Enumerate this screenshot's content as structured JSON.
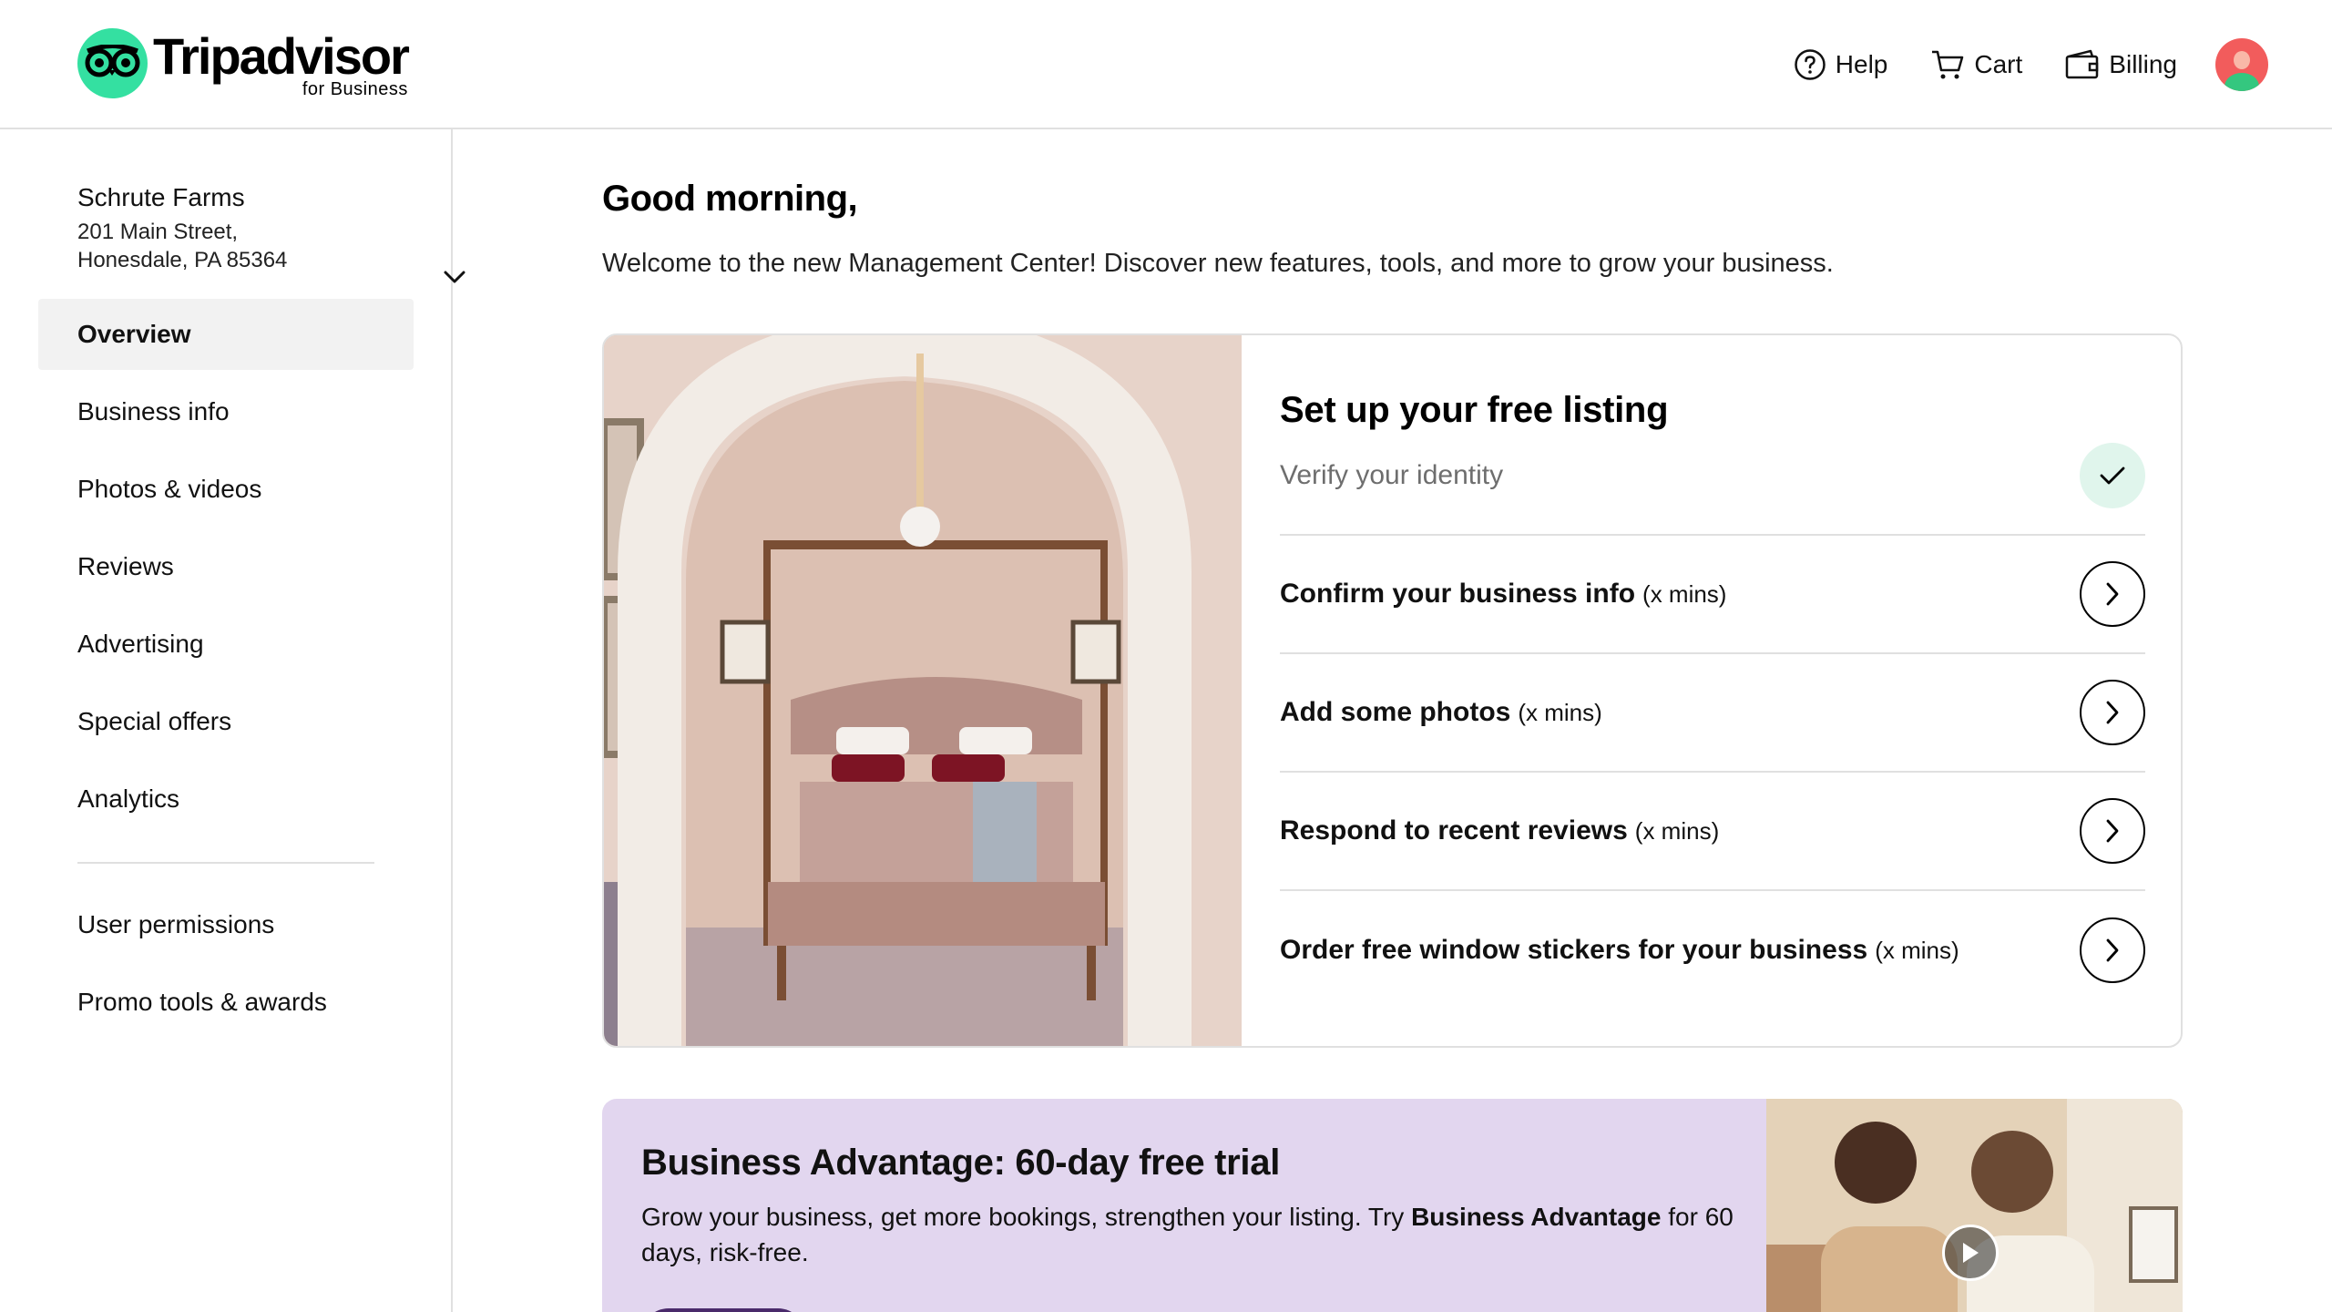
{
  "header": {
    "brand": "Tripadvisor",
    "brand_sub": "for Business",
    "nav": {
      "help": "Help",
      "cart": "Cart",
      "billing": "Billing"
    }
  },
  "sidebar": {
    "business": {
      "name": "Schrute Farms",
      "address_line1": "201 Main Street,",
      "address_line2": "Honesdale, PA 85364"
    },
    "items": [
      {
        "label": "Overview",
        "active": true
      },
      {
        "label": "Business info"
      },
      {
        "label": "Photos & videos"
      },
      {
        "label": "Reviews"
      },
      {
        "label": "Advertising"
      },
      {
        "label": "Special offers"
      },
      {
        "label": "Analytics"
      }
    ],
    "secondary_items": [
      {
        "label": "User permissions"
      },
      {
        "label": "Promo tools & awards"
      }
    ]
  },
  "main": {
    "greeting": "Good morning,",
    "welcome": "Welcome to the new Management Center! Discover new features, tools, and more to grow your business.",
    "listing": {
      "title": "Set up your free listing",
      "tasks": [
        {
          "label": "Verify your identity",
          "mins": "",
          "status": "done"
        },
        {
          "label": "Confirm your business info",
          "mins": "(x mins)",
          "status": "todo"
        },
        {
          "label": "Add some photos",
          "mins": "(x mins)",
          "status": "todo"
        },
        {
          "label": "Respond to recent reviews",
          "mins": "(x mins)",
          "status": "todo"
        },
        {
          "label": "Order free window stickers for your business",
          "mins": "(x mins)",
          "status": "todo"
        }
      ]
    },
    "promo": {
      "title": "Business Advantage: 60-day free trial",
      "desc_before": "Grow your business, get more bookings, strengthen your listing. Try ",
      "desc_bold": "Business Advantage",
      "desc_after": " for 60 days, risk-free."
    }
  },
  "colors": {
    "brand_green": "#34e0a1",
    "promo_bg": "#e2d6ef",
    "active_bg": "#f2f2f2",
    "check_bg": "#e0f5ec"
  },
  "icons": {
    "logo": "owl-eyes-icon",
    "help": "question-circle-icon",
    "cart": "shopping-cart-icon",
    "billing": "wallet-icon",
    "expand": "chevron-down-icon",
    "done": "checkmark-icon",
    "go": "chevron-right-icon",
    "video": "play-icon"
  }
}
